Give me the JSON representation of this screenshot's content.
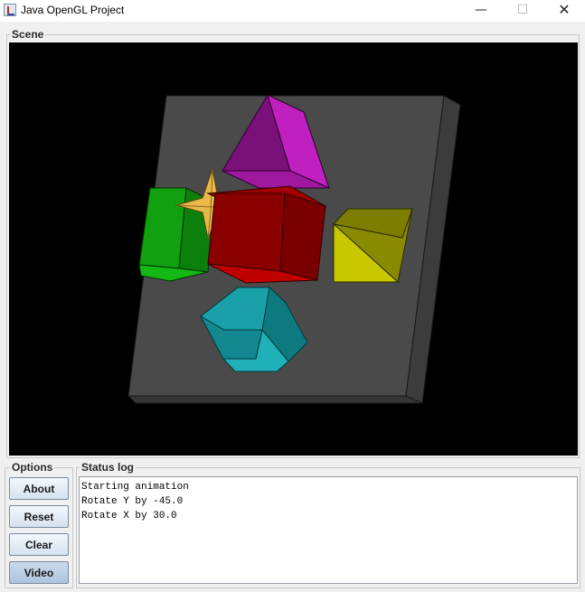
{
  "window": {
    "title": "Java OpenGL Project",
    "controls": {
      "minimize": "—",
      "maximize": "☐",
      "close": "✕"
    }
  },
  "scene": {
    "label": "Scene",
    "background_color": "#000000",
    "objects": [
      {
        "name": "base-slab",
        "color": "#4a4a4a"
      },
      {
        "name": "pyramid",
        "color": "#a020a0"
      },
      {
        "name": "green-cube",
        "color": "#10a010"
      },
      {
        "name": "red-cube",
        "color": "#c00000"
      },
      {
        "name": "yellow-pyramid",
        "color": "#c8c800"
      },
      {
        "name": "cyan-polyhedron",
        "color": "#20b0b8"
      },
      {
        "name": "gold-star",
        "color": "#e8b848"
      }
    ]
  },
  "options": {
    "label": "Options",
    "buttons": {
      "about": "About",
      "reset": "Reset",
      "clear": "Clear",
      "video": "Video"
    }
  },
  "status_log": {
    "label": "Status log",
    "lines": [
      "Starting animation",
      "Rotate Y by -45.0",
      "Rotate X by 30.0"
    ]
  }
}
